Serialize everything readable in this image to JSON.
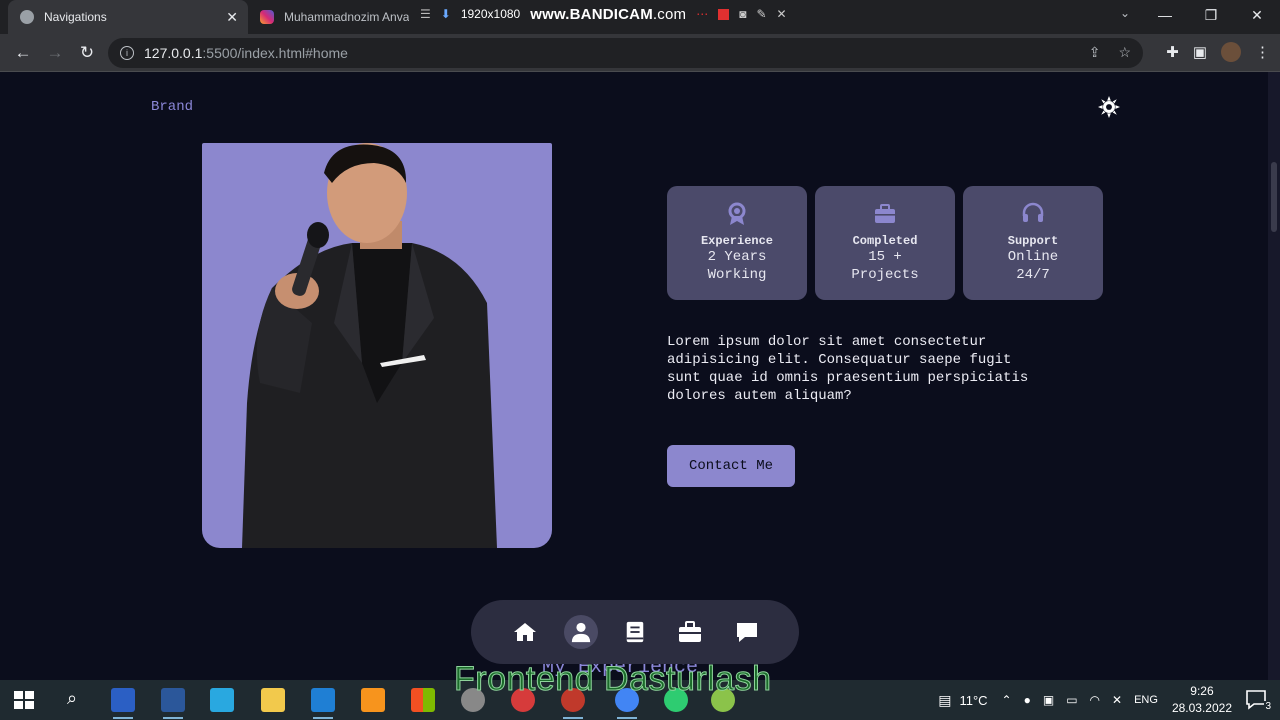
{
  "browser": {
    "tabs": [
      {
        "title": "Navigations",
        "active": true
      },
      {
        "title": "Muhammadnozim Anva",
        "active": false
      }
    ],
    "recorder": {
      "resolution": "1920x1080",
      "brand_main": "www.BANDICAM",
      "brand_suffix": ".com"
    },
    "url_host": "127.0.0.1",
    "url_path": ":5500/index.html#home"
  },
  "site": {
    "brand": "Brand",
    "cards": [
      {
        "title": "Experience",
        "line1": "2 Years",
        "line2": "Working",
        "icon": "award-icon"
      },
      {
        "title": "Completed",
        "line1": "15 +",
        "line2": "Projects",
        "icon": "briefcase-icon"
      },
      {
        "title": "Support",
        "line1": "Online",
        "line2": "24/7",
        "icon": "headset-icon"
      }
    ],
    "description": "Lorem ipsum dolor sit amet consectetur adipisicing elit. Consequatur saepe fugit sunt quae id omnis praesentium perspiciatis dolores autem aliquam?",
    "contact_label": "Contact Me",
    "next_section_heading": "My Experience",
    "bottom_nav": [
      "home-icon",
      "user-icon",
      "book-icon",
      "briefcase-icon",
      "chat-icon"
    ],
    "active_nav": "user-icon"
  },
  "watermark": "Frontend Dasturlash",
  "taskbar": {
    "temperature": "11°C",
    "language": "ENG",
    "time": "9:26",
    "date": "28.03.2022",
    "notifications": "3"
  },
  "colors": {
    "accent": "#8c87ce",
    "background": "#0b0d1c",
    "card": "#4b4a6a"
  }
}
